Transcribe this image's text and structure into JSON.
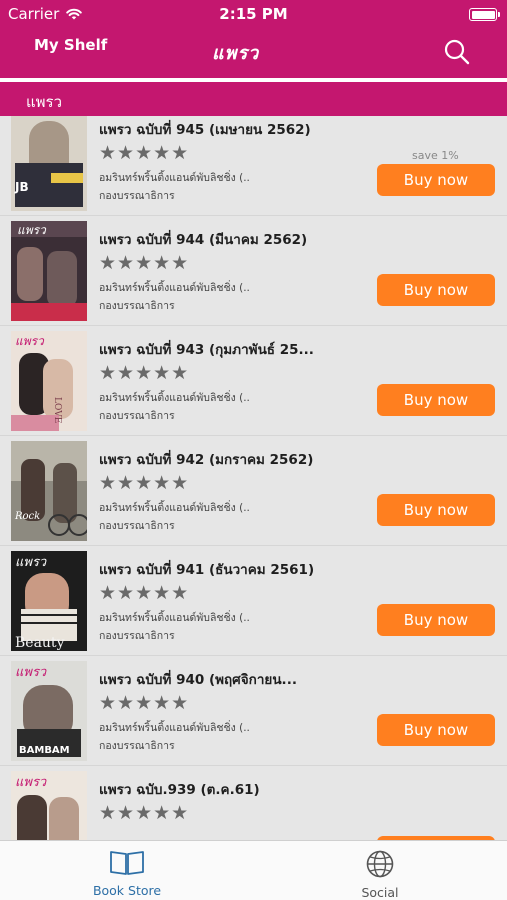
{
  "status": {
    "carrier": "Carrier",
    "time": "2:15 PM"
  },
  "nav": {
    "my_shelf": "My Shelf",
    "logo": "แพรว"
  },
  "category": "แพรว",
  "items": [
    {
      "title": "แพรว ฉบับที่ 945 (เมษายน 2562)",
      "stars": "★★★★★",
      "publisher": "อมรินทร์พริ้นติ้งแอนด์พับลิชชิ่ง (...",
      "author": "กองบรรณาธิการ",
      "save": "save 1%",
      "buy": "Buy now",
      "cover_text": "JB"
    },
    {
      "title": "แพรว ฉบับที่ 944 (มีนาคม 2562)",
      "stars": "★★★★★",
      "publisher": "อมรินทร์พริ้นติ้งแอนด์พับลิชชิ่ง (...",
      "author": "กองบรรณาธิการ",
      "save": "",
      "buy": "Buy now",
      "cover_text": ""
    },
    {
      "title": "แพรว ฉบับที่ 943 (กุมภาพันธ์ 25...",
      "stars": "★★★★★",
      "publisher": "อมรินทร์พริ้นติ้งแอนด์พับลิชชิ่ง (...",
      "author": "กองบรรณาธิการ",
      "save": "",
      "buy": "Buy now",
      "cover_text": "LOVE"
    },
    {
      "title": "แพรว ฉบับที่ 942 (มกราคม 2562)",
      "stars": "★★★★★",
      "publisher": "อมรินทร์พริ้นติ้งแอนด์พับลิชชิ่ง (...",
      "author": "กองบรรณาธิการ",
      "save": "",
      "buy": "Buy now",
      "cover_text": "Rock"
    },
    {
      "title": "แพรว ฉบับที่ 941 (ธันวาคม 2561)",
      "stars": "★★★★★",
      "publisher": "อมรินทร์พริ้นติ้งแอนด์พับลิชชิ่ง (...",
      "author": "กองบรรณาธิการ",
      "save": "",
      "buy": "Buy now",
      "cover_text": "Beauty"
    },
    {
      "title": "แพรว ฉบับที่ 940 (พฤศจิกายน...",
      "stars": "★★★★★",
      "publisher": "อมรินทร์พริ้นติ้งแอนด์พับลิชชิ่ง (...",
      "author": "กองบรรณาธิการ",
      "save": "",
      "buy": "Buy now",
      "cover_text": "BAMBAM"
    },
    {
      "title": "แพรว ฉบับ.939 (ต.ค.61)",
      "stars": "★★★★★",
      "publisher": "",
      "author": "",
      "save": "",
      "buy": "",
      "cover_text": ""
    }
  ],
  "tabs": {
    "bookstore": "Book Store",
    "social": "Social"
  },
  "colors": {
    "brand": "#c4176f",
    "buy": "#ff7f1f",
    "tab_active": "#2d6fa6"
  }
}
